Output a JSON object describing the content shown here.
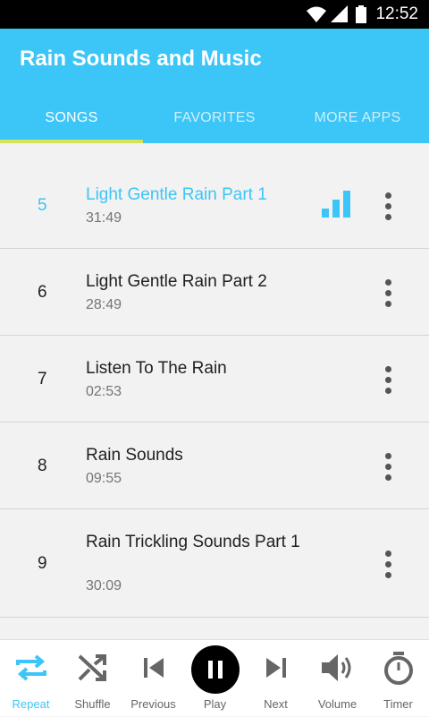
{
  "status": {
    "time": "12:52"
  },
  "app": {
    "title": "Rain Sounds and Music"
  },
  "tabs": [
    {
      "label": "SONGS",
      "active": true
    },
    {
      "label": "FAVORITES",
      "active": false
    },
    {
      "label": "MORE APPS",
      "active": false
    }
  ],
  "songs": [
    {
      "num": "5",
      "title": "Light Gentle Rain Part 1",
      "duration": "31:49",
      "playing": true
    },
    {
      "num": "6",
      "title": "Light Gentle Rain Part 2",
      "duration": "28:49",
      "playing": false
    },
    {
      "num": "7",
      "title": "Listen To The Rain",
      "duration": "02:53",
      "playing": false
    },
    {
      "num": "8",
      "title": "Rain Sounds",
      "duration": "09:55",
      "playing": false
    },
    {
      "num": "9",
      "title": "Rain Trickling Sounds Part 1",
      "duration": "30:09",
      "playing": false
    }
  ],
  "controls": {
    "repeat": "Repeat",
    "shuffle": "Shuffle",
    "previous": "Previous",
    "play": "Play",
    "next": "Next",
    "volume": "Volume",
    "timer": "Timer"
  },
  "colors": {
    "accent": "#3cc5f7",
    "tab_indicator": "#d4e35a"
  }
}
